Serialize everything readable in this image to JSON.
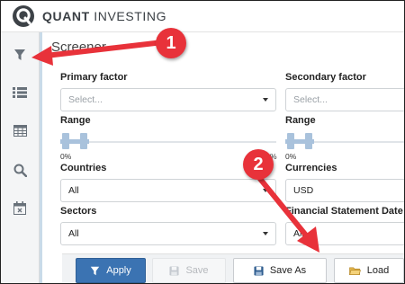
{
  "app": {
    "brand_bold": "QUANT",
    "brand_rest": " INVESTING"
  },
  "sidebar": {
    "items": [
      {
        "icon": "filter-icon"
      },
      {
        "icon": "list-icon"
      },
      {
        "icon": "table-icon"
      },
      {
        "icon": "search-icon"
      },
      {
        "icon": "calendar-icon"
      }
    ]
  },
  "screener": {
    "title": "Screener",
    "primary_factor": {
      "label": "Primary factor",
      "placeholder": "Select..."
    },
    "secondary_factor": {
      "label": "Secondary factor",
      "placeholder": "Select..."
    },
    "range_left": {
      "label": "Range",
      "min_label": "0%",
      "max_label": "%"
    },
    "range_right": {
      "label": "Range",
      "min_label": "0%"
    },
    "countries": {
      "label": "Countries",
      "value": "All"
    },
    "currencies": {
      "label": "Currencies",
      "value": "USD"
    },
    "sectors": {
      "label": "Sectors",
      "value": "All"
    },
    "financial_statement_date": {
      "label": "Financial Statement Date f",
      "value": "All"
    }
  },
  "toolbar": {
    "apply_label": "Apply",
    "save_label": "Save",
    "save_as_label": "Save As",
    "load_label": "Load"
  },
  "annotations": {
    "badge_1": "1",
    "badge_2": "2"
  },
  "colors": {
    "primary_button": "#3b73b2",
    "annotation_red": "#e8323a",
    "slider_handle": "#a9c2dc"
  }
}
